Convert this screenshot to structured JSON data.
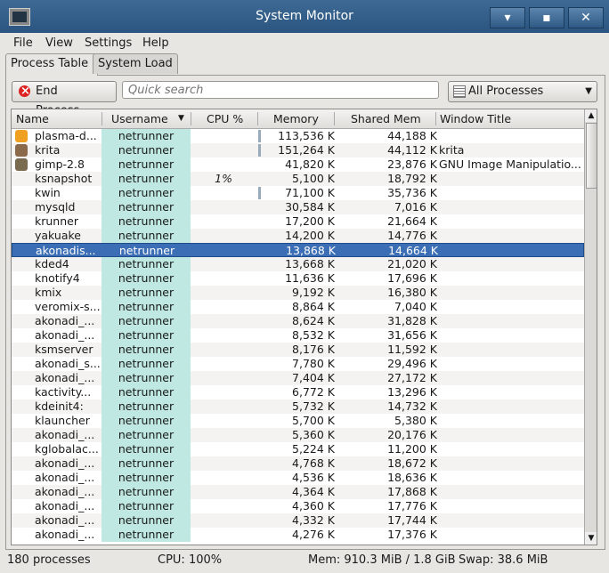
{
  "window": {
    "title": "System Monitor",
    "minimize": "▾",
    "maximize": "▪",
    "close": "✕"
  },
  "menu": [
    "File",
    "View",
    "Settings",
    "Help"
  ],
  "tabs": [
    "Process Table",
    "System Load"
  ],
  "toolbar": {
    "end_process": "End Process...",
    "search_placeholder": "Quick search",
    "filter": "All Processes"
  },
  "columns": [
    "Name",
    "Username",
    "CPU %",
    "Memory",
    "Shared Mem",
    "Window Title"
  ],
  "processes": [
    {
      "name": "plasma-d...",
      "user": "netrunner",
      "cpu": "",
      "mem": "113,536 K",
      "shared": "44,188 K",
      "title": "",
      "icon": "plasma-icon",
      "bar": true
    },
    {
      "name": "krita",
      "user": "netrunner",
      "cpu": "",
      "mem": "151,264 K",
      "shared": "44,112 K",
      "title": "krita",
      "icon": "krita-icon",
      "bar": true
    },
    {
      "name": "gimp-2.8",
      "user": "netrunner",
      "cpu": "",
      "mem": "41,820 K",
      "shared": "23,876 K",
      "title": "GNU Image Manipulatio...",
      "icon": "gimp-icon"
    },
    {
      "name": "ksnapshot",
      "user": "netrunner",
      "cpu": "1%",
      "mem": "5,100 K",
      "shared": "18,792 K",
      "title": ""
    },
    {
      "name": "kwin",
      "user": "netrunner",
      "cpu": "",
      "mem": "71,100 K",
      "shared": "35,736 K",
      "title": "",
      "bar": true
    },
    {
      "name": "mysqld",
      "user": "netrunner",
      "cpu": "",
      "mem": "30,584 K",
      "shared": "7,016 K",
      "title": ""
    },
    {
      "name": "krunner",
      "user": "netrunner",
      "cpu": "",
      "mem": "17,200 K",
      "shared": "21,664 K",
      "title": ""
    },
    {
      "name": "yakuake",
      "user": "netrunner",
      "cpu": "",
      "mem": "14,200 K",
      "shared": "14,776 K",
      "title": ""
    },
    {
      "name": "akonadis...",
      "user": "netrunner",
      "cpu": "",
      "mem": "13,868 K",
      "shared": "14,664 K",
      "title": "",
      "selected": true
    },
    {
      "name": "kded4",
      "user": "netrunner",
      "cpu": "",
      "mem": "13,668 K",
      "shared": "21,020 K",
      "title": ""
    },
    {
      "name": "knotify4",
      "user": "netrunner",
      "cpu": "",
      "mem": "11,636 K",
      "shared": "17,696 K",
      "title": ""
    },
    {
      "name": "kmix",
      "user": "netrunner",
      "cpu": "",
      "mem": "9,192 K",
      "shared": "16,380 K",
      "title": ""
    },
    {
      "name": "veromix-s...",
      "user": "netrunner",
      "cpu": "",
      "mem": "8,864 K",
      "shared": "7,040 K",
      "title": ""
    },
    {
      "name": "akonadi_...",
      "user": "netrunner",
      "cpu": "",
      "mem": "8,624 K",
      "shared": "31,828 K",
      "title": ""
    },
    {
      "name": "akonadi_...",
      "user": "netrunner",
      "cpu": "",
      "mem": "8,532 K",
      "shared": "31,656 K",
      "title": ""
    },
    {
      "name": "ksmserver",
      "user": "netrunner",
      "cpu": "",
      "mem": "8,176 K",
      "shared": "11,592 K",
      "title": ""
    },
    {
      "name": "akonadi_s...",
      "user": "netrunner",
      "cpu": "",
      "mem": "7,780 K",
      "shared": "29,496 K",
      "title": ""
    },
    {
      "name": "akonadi_...",
      "user": "netrunner",
      "cpu": "",
      "mem": "7,404 K",
      "shared": "27,172 K",
      "title": ""
    },
    {
      "name": "kactivity...",
      "user": "netrunner",
      "cpu": "",
      "mem": "6,772 K",
      "shared": "13,296 K",
      "title": ""
    },
    {
      "name": "kdeinit4:",
      "user": "netrunner",
      "cpu": "",
      "mem": "5,732 K",
      "shared": "14,732 K",
      "title": ""
    },
    {
      "name": "klauncher",
      "user": "netrunner",
      "cpu": "",
      "mem": "5,700 K",
      "shared": "5,380 K",
      "title": ""
    },
    {
      "name": "akonadi_...",
      "user": "netrunner",
      "cpu": "",
      "mem": "5,360 K",
      "shared": "20,176 K",
      "title": ""
    },
    {
      "name": "kglobalac...",
      "user": "netrunner",
      "cpu": "",
      "mem": "5,224 K",
      "shared": "11,200 K",
      "title": ""
    },
    {
      "name": "akonadi_...",
      "user": "netrunner",
      "cpu": "",
      "mem": "4,768 K",
      "shared": "18,672 K",
      "title": ""
    },
    {
      "name": "akonadi_...",
      "user": "netrunner",
      "cpu": "",
      "mem": "4,536 K",
      "shared": "18,636 K",
      "title": ""
    },
    {
      "name": "akonadi_...",
      "user": "netrunner",
      "cpu": "",
      "mem": "4,364 K",
      "shared": "17,868 K",
      "title": ""
    },
    {
      "name": "akonadi_...",
      "user": "netrunner",
      "cpu": "",
      "mem": "4,360 K",
      "shared": "17,776 K",
      "title": ""
    },
    {
      "name": "akonadi_...",
      "user": "netrunner",
      "cpu": "",
      "mem": "4,332 K",
      "shared": "17,744 K",
      "title": ""
    },
    {
      "name": "akonadi_...",
      "user": "netrunner",
      "cpu": "",
      "mem": "4,276 K",
      "shared": "17,376 K",
      "title": ""
    }
  ],
  "status": {
    "processes": "180 processes",
    "cpu": "CPU: 100%",
    "mem": "Mem: 910.3 MiB / 1.8 GiB",
    "swap": "Swap: 38.6 MiB"
  }
}
